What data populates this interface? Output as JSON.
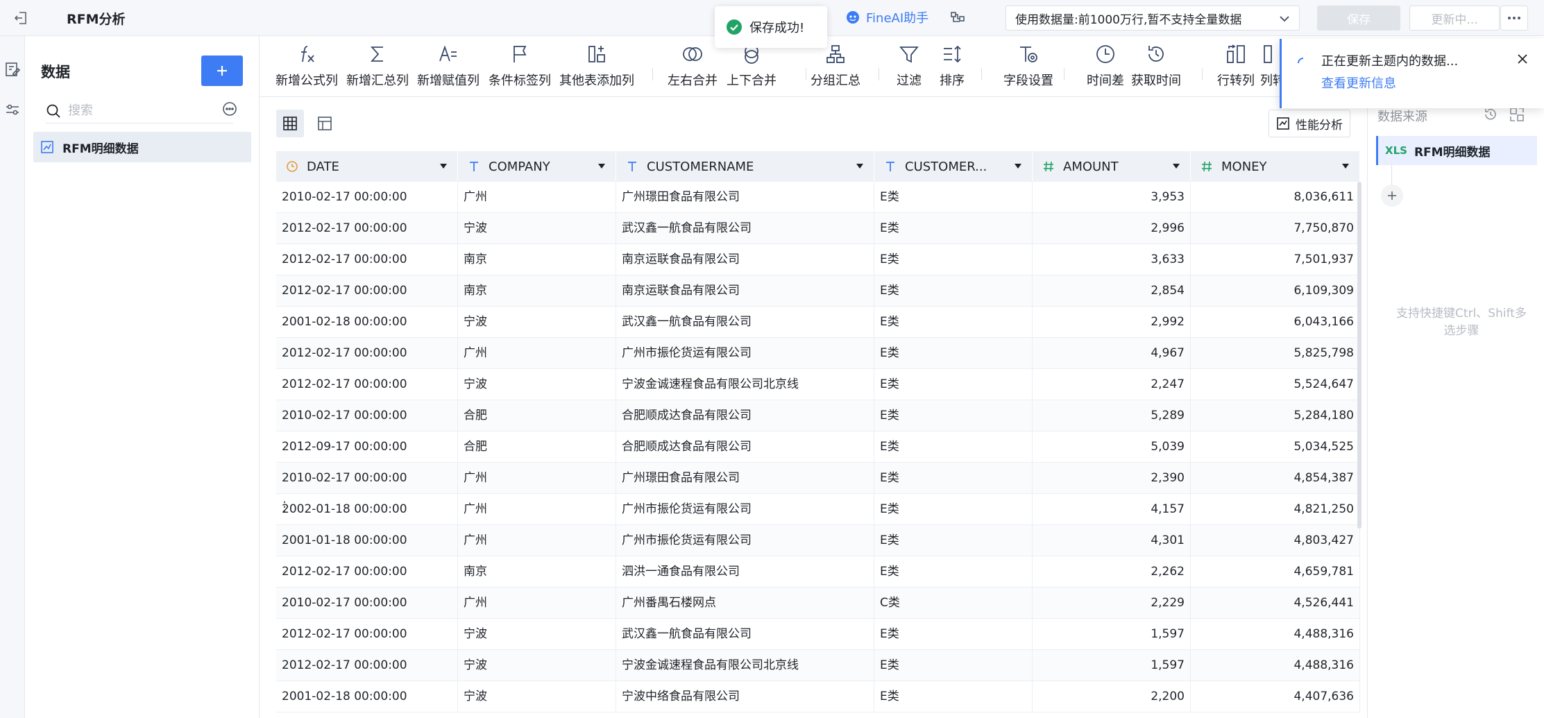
{
  "header": {
    "title": "RFM分析",
    "toast": "保存成功!",
    "ai_label": "FineAI助手",
    "data_volume": "使用数据量:前1000万行,暂不支持全量数据",
    "save_label": "保存",
    "update_label": "更新中..."
  },
  "sidebar": {
    "title": "数据",
    "search_placeholder": "搜索",
    "items": [
      {
        "label": "RFM明细数据"
      }
    ]
  },
  "toolbar": {
    "items": [
      {
        "label": "新增公式列",
        "icon": "formula-icon"
      },
      {
        "label": "新增汇总列",
        "icon": "sum-icon"
      },
      {
        "label": "新增赋值列",
        "icon": "assign-icon"
      },
      {
        "label": "条件标签列",
        "icon": "flag-icon"
      },
      {
        "label": "其他表添加列",
        "icon": "add-column-icon"
      },
      {
        "label": "左右合并",
        "icon": "merge-lr-icon"
      },
      {
        "label": "上下合并",
        "icon": "merge-ud-icon"
      },
      {
        "label": "分组汇总",
        "icon": "group-icon"
      },
      {
        "label": "过滤",
        "icon": "filter-icon"
      },
      {
        "label": "排序",
        "icon": "sort-icon"
      },
      {
        "label": "字段设置",
        "icon": "field-settings-icon"
      },
      {
        "label": "时间差",
        "icon": "time-diff-icon"
      },
      {
        "label": "获取时间",
        "icon": "get-time-icon"
      },
      {
        "label": "行转列",
        "icon": "row-to-col-icon"
      },
      {
        "label": "列转",
        "icon": "col-to-row-icon"
      }
    ]
  },
  "view": {
    "perf_label": "性能分析"
  },
  "table": {
    "columns": [
      {
        "name": "DATE",
        "type": "date"
      },
      {
        "name": "COMPANY",
        "type": "text"
      },
      {
        "name": "CUSTOMERNAME",
        "type": "text"
      },
      {
        "name": "CUSTOMER...",
        "type": "text"
      },
      {
        "name": "AMOUNT",
        "type": "number"
      },
      {
        "name": "MONEY",
        "type": "number"
      }
    ],
    "rows": [
      [
        "2010-02-17 00:00:00",
        "广州",
        "广州璟田食品有限公司",
        "E类",
        "3,953",
        "8,036,611"
      ],
      [
        "2012-02-17 00:00:00",
        "宁波",
        "武汉鑫一航食品有限公司",
        "E类",
        "2,996",
        "7,750,870"
      ],
      [
        "2012-02-17 00:00:00",
        "南京",
        "南京运联食品有限公司",
        "E类",
        "3,633",
        "7,501,937"
      ],
      [
        "2012-02-17 00:00:00",
        "南京",
        "南京运联食品有限公司",
        "E类",
        "2,854",
        "6,109,309"
      ],
      [
        "2001-02-18 00:00:00",
        "宁波",
        "武汉鑫一航食品有限公司",
        "E类",
        "2,992",
        "6,043,166"
      ],
      [
        "2012-02-17 00:00:00",
        "广州",
        "广州市振伦货运有限公司",
        "E类",
        "4,967",
        "5,825,798"
      ],
      [
        "2012-02-17 00:00:00",
        "宁波",
        "宁波金诚速程食品有限公司北京线",
        "E类",
        "2,247",
        "5,524,647"
      ],
      [
        "2010-02-17 00:00:00",
        "合肥",
        "合肥顺成达食品有限公司",
        "E类",
        "5,289",
        "5,284,180"
      ],
      [
        "2012-09-17 00:00:00",
        "合肥",
        "合肥顺成达食品有限公司",
        "E类",
        "5,039",
        "5,034,525"
      ],
      [
        "2010-02-17 00:00:00",
        "广州",
        "广州璟田食品有限公司",
        "E类",
        "2,390",
        "4,854,387"
      ],
      [
        "2002-01-18 00:00:00",
        "广州",
        "广州市振伦货运有限公司",
        "E类",
        "4,157",
        "4,821,250"
      ],
      [
        "2001-01-18 00:00:00",
        "广州",
        "广州市振伦货运有限公司",
        "E类",
        "4,301",
        "4,803,427"
      ],
      [
        "2012-02-17 00:00:00",
        "南京",
        "泗洪一通食品有限公司",
        "E类",
        "2,262",
        "4,659,781"
      ],
      [
        "2010-02-17 00:00:00",
        "广州",
        "广州番禺石楼网点",
        "C类",
        "2,229",
        "4,526,441"
      ],
      [
        "2012-02-17 00:00:00",
        "宁波",
        "武汉鑫一航食品有限公司",
        "E类",
        "1,597",
        "4,488,316"
      ],
      [
        "2012-02-17 00:00:00",
        "宁波",
        "宁波金诚速程食品有限公司北京线",
        "E类",
        "1,597",
        "4,488,316"
      ],
      [
        "2001-02-18 00:00:00",
        "宁波",
        "宁波中络食品有限公司",
        "E类",
        "2,200",
        "4,407,636"
      ]
    ]
  },
  "sources": {
    "title": "数据来源",
    "item_badge": "XLS",
    "item_label": "RFM明细数据",
    "hint": "支持快捷键Ctrl、Shift多选步骤"
  },
  "notice": {
    "title": "正在更新主题内的数据...",
    "link": "查看更新信息"
  },
  "colors": {
    "accent": "#3d7cf4",
    "success": "#21a366"
  }
}
